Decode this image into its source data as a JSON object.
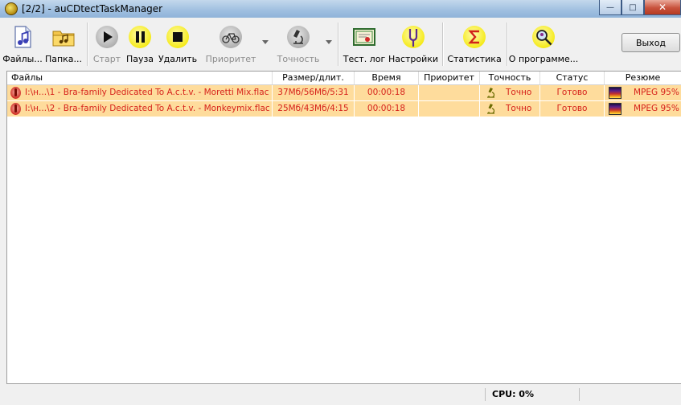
{
  "window": {
    "title": "[2/2] - auCDtectTaskManager",
    "buttons": {
      "minimize": "—",
      "maximize": "□",
      "close": "✕"
    }
  },
  "toolbar": {
    "files": "Файлы...",
    "folder": "Папка...",
    "start": "Старт",
    "pause": "Пауза",
    "delete": "Удалить",
    "priority": "Приоритет",
    "accuracy": "Точность",
    "test_log": "Тест. лог",
    "settings": "Настройки",
    "statistics": "Статистика",
    "about": "О программе...",
    "exit": "Выход"
  },
  "table": {
    "columns": [
      "Файлы",
      "Размер/длит.",
      "Время",
      "Приоритет",
      "Точность",
      "Статус",
      "Резюме"
    ],
    "rows": [
      {
        "file": "I:\\н...\\1 - Bra-family Dedicated To A.c.t.v. - Moretti Mix.flac",
        "size": "37Мб/56Мб/5:31",
        "time": "00:00:18",
        "priority": "",
        "accuracy": "Точно",
        "status": "Готово",
        "summary": "MPEG 95%"
      },
      {
        "file": "I:\\н...\\2 - Bra-family Dedicated To A.c.t.v. - Monkeymix.flac",
        "size": "25Мб/43Мб/4:15",
        "time": "00:00:18",
        "priority": "",
        "accuracy": "Точно",
        "status": "Готово",
        "summary": "MPEG 95%"
      }
    ]
  },
  "statusbar": {
    "cpu": "CPU: 0%"
  },
  "colors": {
    "row_bg": "#fedc9c",
    "row_text": "#d6221b",
    "title_bar": "#9fbfe0"
  }
}
